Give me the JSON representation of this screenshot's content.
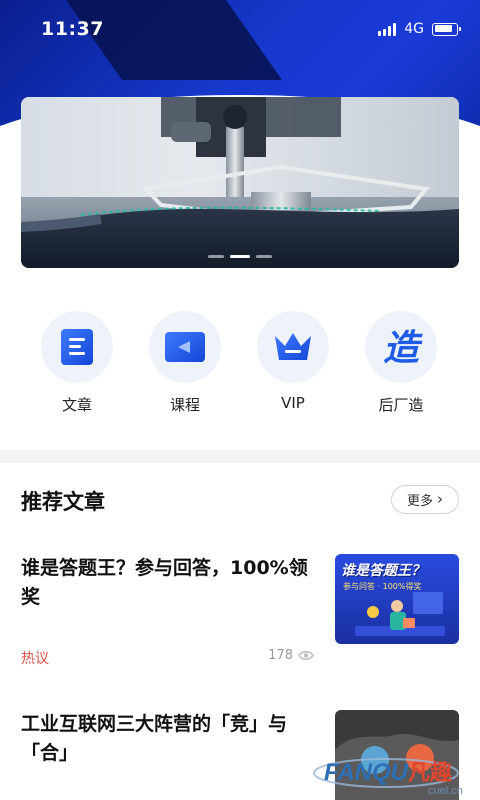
{
  "status_bar": {
    "time": "11:37",
    "network": "4G"
  },
  "banner": {
    "dot_count": 3,
    "active_index": 1
  },
  "quick_menu": [
    {
      "label": "文章",
      "icon": "article-icon"
    },
    {
      "label": "课程",
      "icon": "course-play-icon"
    },
    {
      "label": "VIP",
      "icon": "crown-icon"
    },
    {
      "label": "后厂造",
      "icon": "zao-character-icon"
    }
  ],
  "section": {
    "title": "推荐文章",
    "more_label": "更多"
  },
  "articles": [
    {
      "title": "谁是答题王？参与回答，100%领奖",
      "tag": "热议",
      "views": "178",
      "thumb_title": "谁是答题王？",
      "thumb_subtitle": "参与问答 · 100%得奖"
    },
    {
      "title": "工业互联网三大阵营的「竞」与「合」"
    }
  ],
  "watermark": {
    "brand": "FANQU",
    "brand_cn": "凡趣",
    "domain": "cuel.cn"
  },
  "colors": {
    "primary": "#1a3bd8",
    "tag_red": "#d9534f",
    "icon_blue": "#1f5be6"
  }
}
